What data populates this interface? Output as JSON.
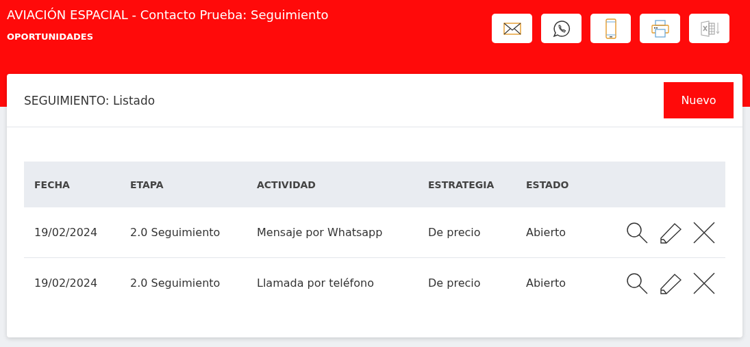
{
  "header": {
    "title": "AVIACIÓN ESPACIAL - Contacto Prueba: Seguimiento",
    "subtitle": "OPORTUNIDADES"
  },
  "card": {
    "title": "SEGUIMIENTO: Listado",
    "new_button": "Nuevo"
  },
  "table": {
    "columns": [
      "FECHA",
      "ETAPA",
      "ACTIVIDAD",
      "ESTRATEGIA",
      "ESTADO"
    ],
    "rows": [
      {
        "cells": [
          "19/02/2024",
          "2.0 Seguimiento",
          "Mensaje por Whatsapp",
          "De precio",
          "Abierto"
        ]
      },
      {
        "cells": [
          "19/02/2024",
          "2.0 Seguimiento",
          "Llamada por teléfono",
          "De precio",
          "Abierto"
        ]
      }
    ]
  }
}
